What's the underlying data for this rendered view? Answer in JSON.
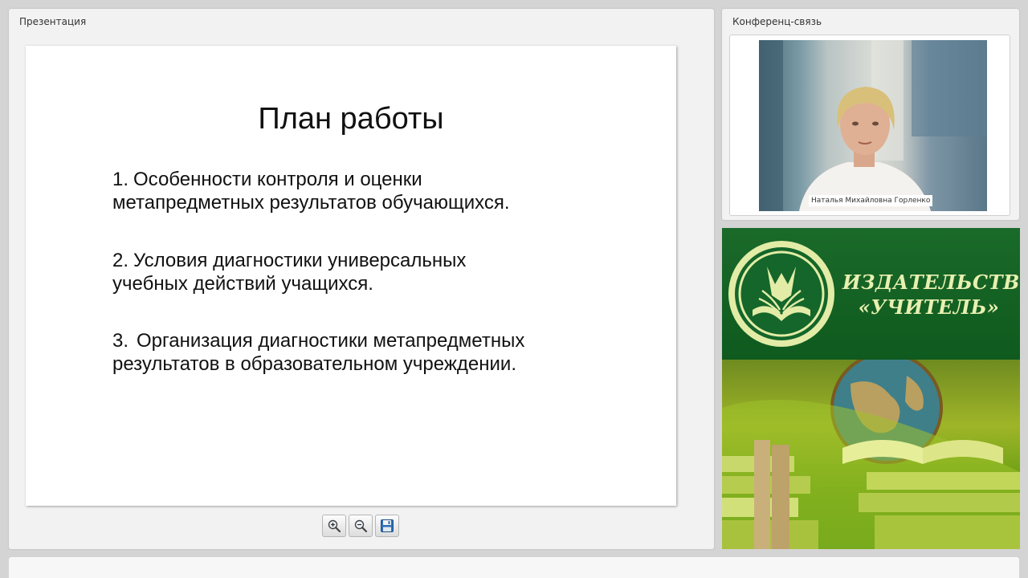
{
  "presentation": {
    "panel_title": "Презентация",
    "slide": {
      "title": "План работы",
      "items": [
        {
          "number": "1.",
          "line1": "Особенности контроля и оценки",
          "line2": "метапредметных результатов обучающихся."
        },
        {
          "number": "2.",
          "line1": "Условия диагностики универсальных",
          "line2": "учебных действий учащихся."
        },
        {
          "number": "3.",
          "line1": "Организация диагностики метапредметных",
          "line2": "результатов в образовательном учреждении."
        }
      ]
    },
    "toolbar": {
      "zoom_in_icon": "zoom-in-icon",
      "zoom_out_icon": "zoom-out-icon",
      "save_icon": "floppy-disk-icon"
    }
  },
  "conference": {
    "panel_title": "Конференц-связь",
    "speaker_name": "Наталья Михайловна Горленко"
  },
  "banner": {
    "line1": "ИЗДАТЕЛЬСТВО",
    "line2": "«УЧИТЕЛЬ»",
    "colors": {
      "dark_green": "#0f5a1e",
      "light_text": "#e8f0b0"
    }
  }
}
